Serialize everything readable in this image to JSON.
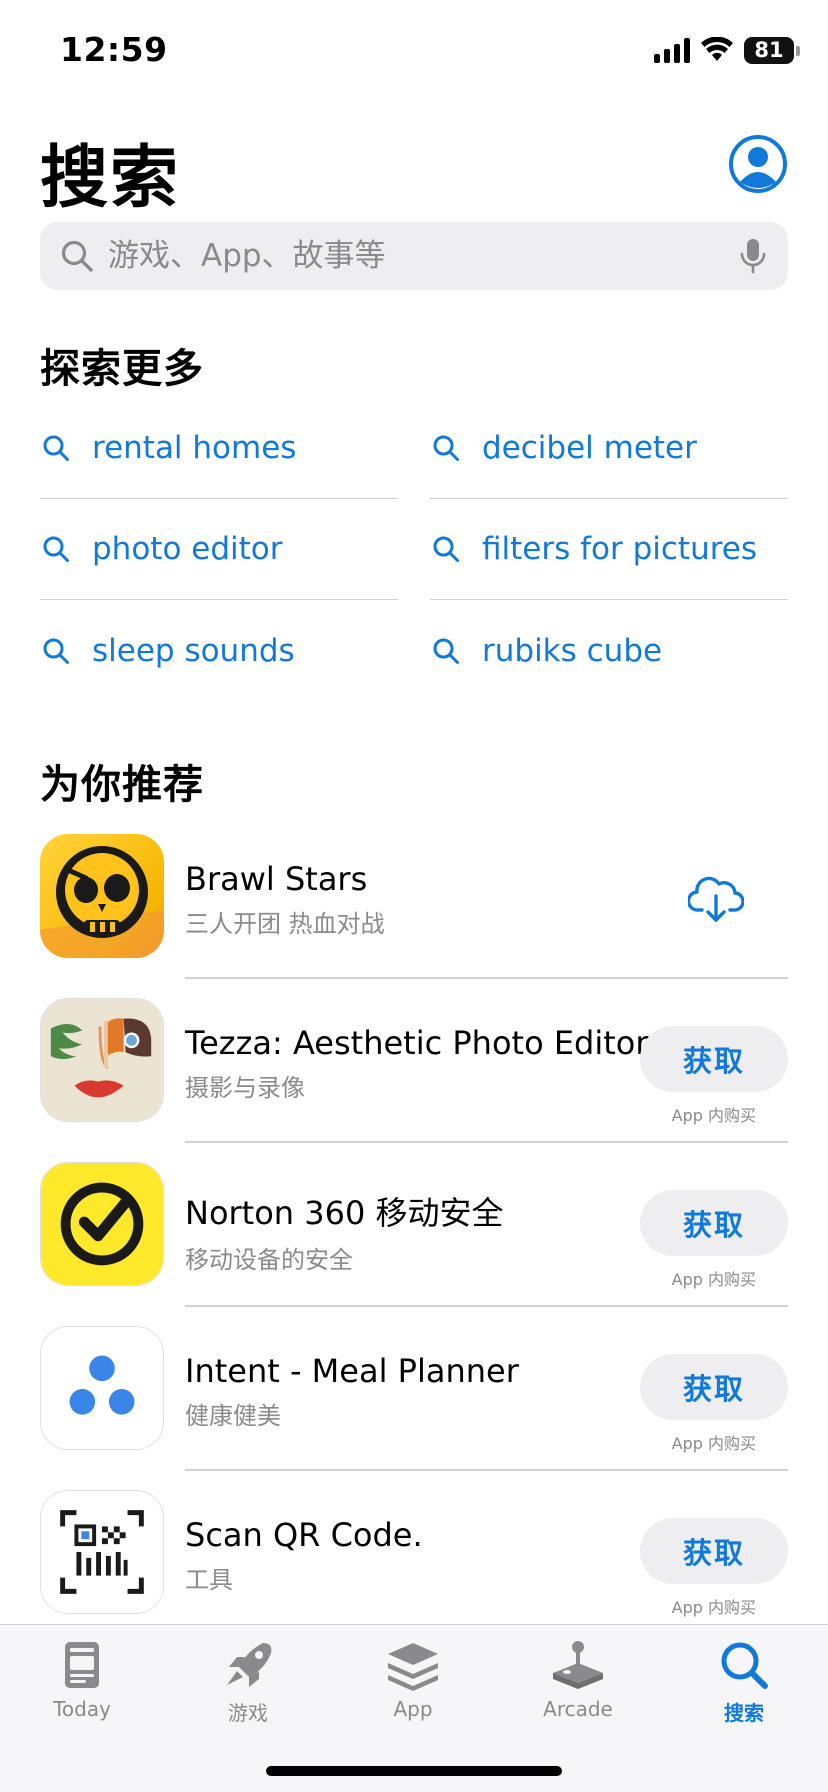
{
  "status_bar": {
    "time": "12:59",
    "battery": "81"
  },
  "header": {
    "title": "搜索"
  },
  "search": {
    "placeholder": "游戏、App、故事等"
  },
  "discover": {
    "title": "探索更多",
    "items": [
      {
        "label": "rental homes"
      },
      {
        "label": "decibel meter"
      },
      {
        "label": "photo editor"
      },
      {
        "label": "filters for pictures"
      },
      {
        "label": "sleep sounds"
      },
      {
        "label": "rubiks cube"
      }
    ]
  },
  "recommended": {
    "title": "为你推荐",
    "apps": [
      {
        "name": "Brawl Stars",
        "subtitle": "三人开团 热血对战",
        "action": "cloud-download-icon"
      },
      {
        "name": "Tezza: Aesthetic Photo Editor",
        "subtitle": "摄影与录像",
        "action_label": "获取",
        "iap": "App 内购买"
      },
      {
        "name": "Norton 360 移动安全",
        "subtitle": "移动设备的安全",
        "action_label": "获取",
        "iap": "App 内购买"
      },
      {
        "name": "Intent - Meal Planner",
        "subtitle": "健康健美",
        "action_label": "获取",
        "iap": "App 内购买"
      },
      {
        "name": "Scan QR Code.",
        "subtitle": "工具",
        "action_label": "获取",
        "iap": "App 内购买"
      }
    ]
  },
  "tabs": [
    {
      "label": "Today",
      "icon": "today-icon"
    },
    {
      "label": "游戏",
      "icon": "rocket-icon"
    },
    {
      "label": "App",
      "icon": "app-stack-icon"
    },
    {
      "label": "Arcade",
      "icon": "joystick-icon"
    },
    {
      "label": "搜索",
      "icon": "search-icon",
      "active": true
    }
  ],
  "colors": {
    "accent": "#1179d9",
    "secondary_text": "#8a8a8e",
    "fill": "#eeeef0"
  }
}
